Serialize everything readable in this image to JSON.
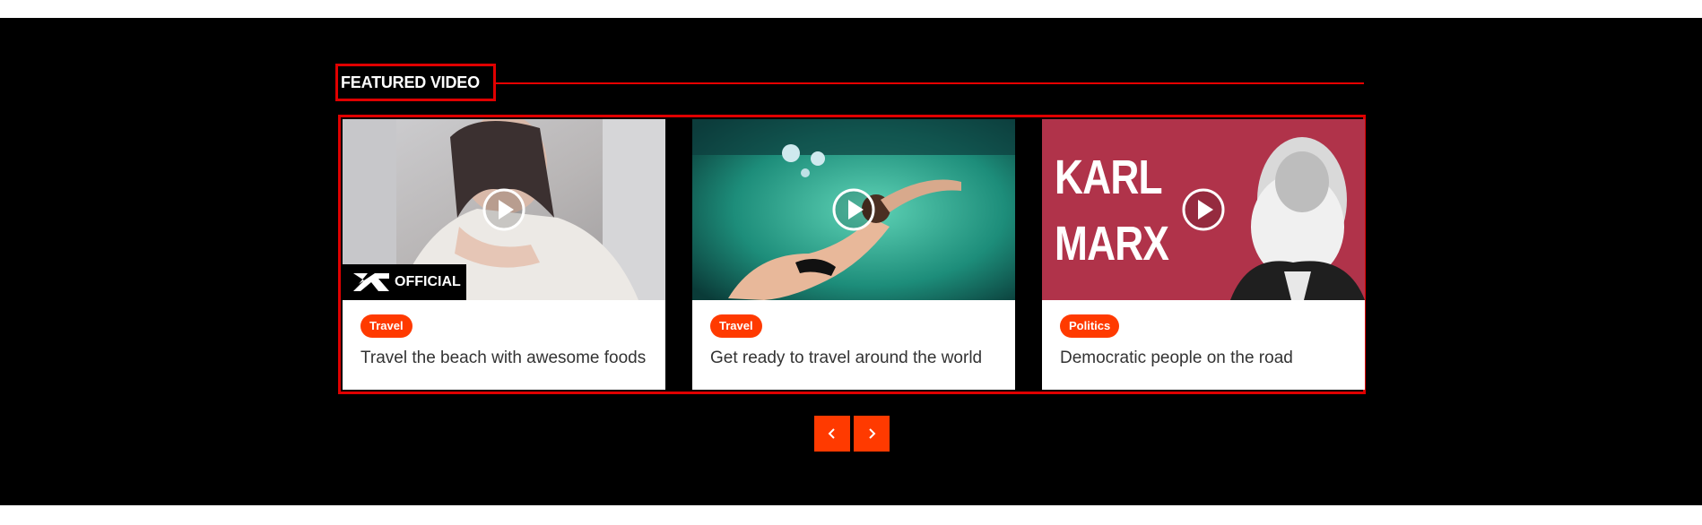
{
  "section": {
    "title": "FEATURED VIDEO",
    "accent_color": "#ff3a00",
    "border_color": "#e00000"
  },
  "cards": [
    {
      "category": "Travel",
      "title": "Travel the beach with awesome foods",
      "thumbnail_overlay": "OFFICIAL",
      "play_icon": "play-circle-icon"
    },
    {
      "category": "Travel",
      "title": "Get ready to travel around the world",
      "play_icon": "play-circle-icon"
    },
    {
      "category": "Politics",
      "title": "Democratic people on the road",
      "thumbnail_text": [
        "KARL",
        "MARX"
      ],
      "play_icon": "play-circle-icon"
    }
  ],
  "pager": {
    "prev_icon": "chevron-left-icon",
    "next_icon": "chevron-right-icon"
  }
}
